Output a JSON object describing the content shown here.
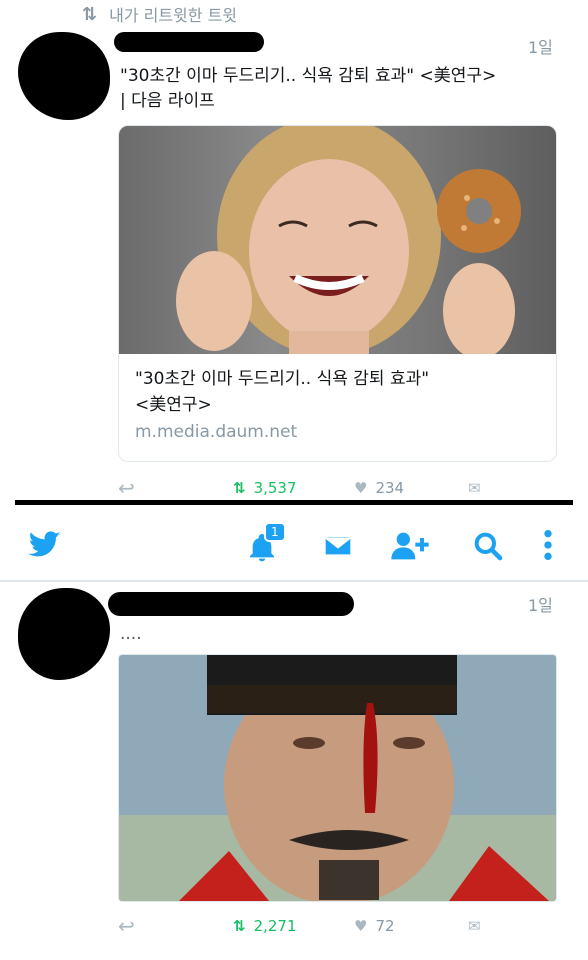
{
  "tweet1": {
    "retweeted_by": "내가 리트윗한 트윗",
    "time": "1일",
    "text_line1": "\"30초간 이마 두드리기.. 식욕 감퇴 효과\" <美연구>",
    "text_line2": "| 다음 라이프",
    "card": {
      "title_line1": "\"30초간 이마 두드리기.. 식욕 감퇴 효과\"",
      "title_line2": "<美연구>",
      "domain": "m.media.daum.net"
    },
    "retweets": "3,537",
    "likes": "234"
  },
  "navbar": {
    "notification_count": "1",
    "accent_color": "#1da1f2"
  },
  "tweet2": {
    "time": "1일",
    "text": "....",
    "retweets": "2,271",
    "likes": "72"
  }
}
